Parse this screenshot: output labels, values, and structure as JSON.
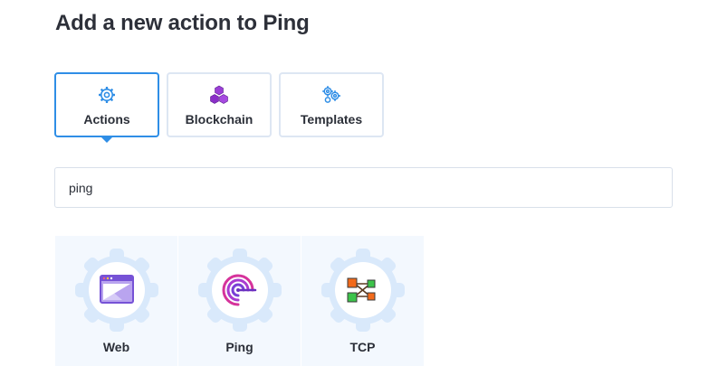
{
  "page": {
    "title": "Add a new action to Ping"
  },
  "tabs": [
    {
      "label": "Actions",
      "icon": "gear-icon",
      "active": true
    },
    {
      "label": "Blockchain",
      "icon": "cubes-icon",
      "active": false
    },
    {
      "label": "Templates",
      "icon": "gears-icon",
      "active": false
    }
  ],
  "search": {
    "value": "ping"
  },
  "results": [
    {
      "label": "Web",
      "icon": "browser-window-icon"
    },
    {
      "label": "Ping",
      "icon": "ping-signal-icon"
    },
    {
      "label": "TCP",
      "icon": "network-nodes-icon"
    }
  ],
  "colors": {
    "accent": "#2f8ee6",
    "card_background": "#f3f8fe",
    "gear_badge": "#d9e9fb"
  }
}
